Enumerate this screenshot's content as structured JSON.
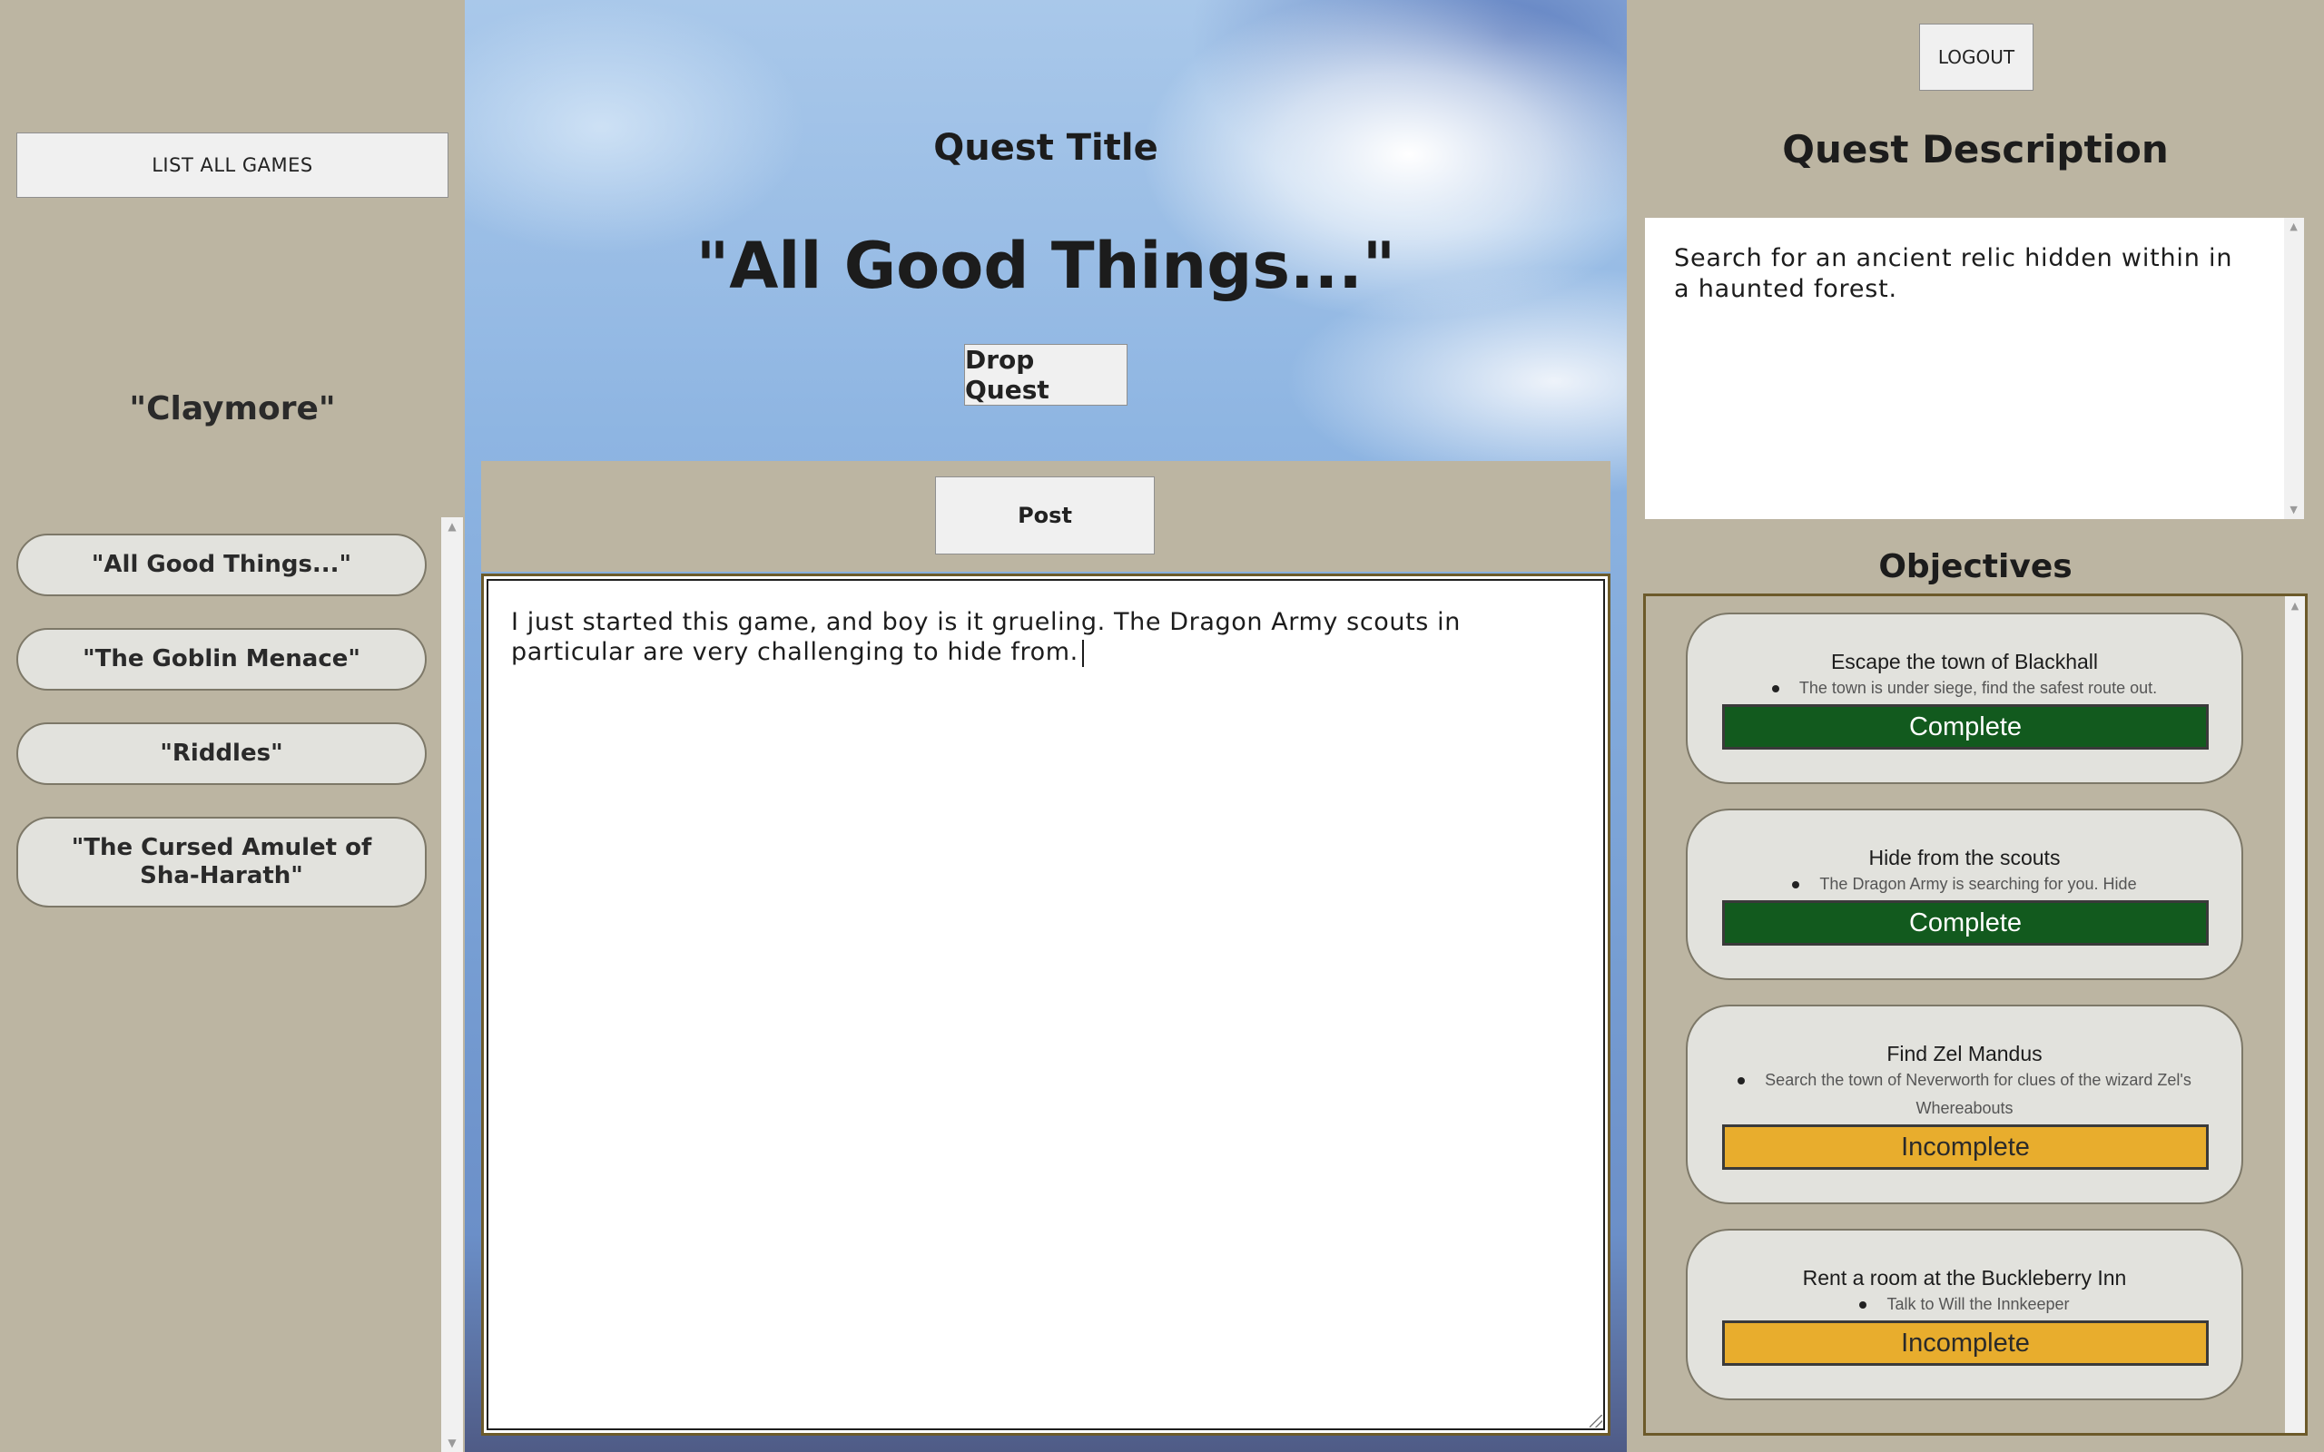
{
  "left": {
    "list_games_label": "LIST ALL GAMES",
    "game_name": "\"Claymore\"",
    "quests": [
      {
        "label": "\"All Good Things...\""
      },
      {
        "label": "\"The Goblin Menace\""
      },
      {
        "label": "\"Riddles\""
      },
      {
        "label": "\"The Cursed Amulet of Sha-Harath\""
      }
    ]
  },
  "center": {
    "heading": "Quest Title",
    "quest_title": "\"All Good Things...\"",
    "drop_label": "Drop Quest",
    "post_label": "Post",
    "post_text": "I just started this game, and boy is it grueling. The Dragon Army scouts in particular are very challenging to hide from."
  },
  "right": {
    "logout_label": "LOGOUT",
    "description_heading": "Quest Description",
    "description_text": "Search for an ancient relic hidden within in a haunted forest.",
    "objectives_heading": "Objectives",
    "objectives": [
      {
        "title": "Escape the town of Blackhall",
        "description": "The town is under siege, find the safest route out.",
        "status": "Complete"
      },
      {
        "title": "Hide from the scouts",
        "description": "The Dragon Army is searching for you. Hide",
        "status": "Complete"
      },
      {
        "title": "Find Zel Mandus",
        "description": "Search the town of Neverworth for clues of the wizard Zel's Whereabouts",
        "status": "Incomplete"
      },
      {
        "title": "Rent a room at the Buckleberry Inn",
        "description": "Talk to Will the Innkeeper",
        "status": "Incomplete"
      }
    ]
  },
  "colors": {
    "panel_bg": "#bcb5a2",
    "complete": "#125a1e",
    "incomplete": "#e8ad2d",
    "border_accent": "#6c5a2a"
  }
}
